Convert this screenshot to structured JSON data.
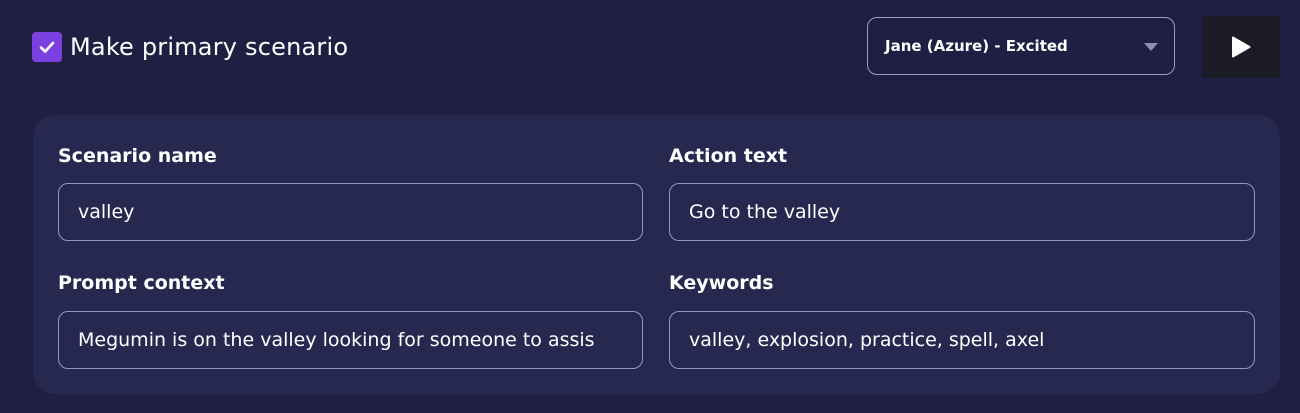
{
  "header": {
    "primary_checkbox": {
      "label": "Make primary scenario",
      "checked": true
    },
    "voice_select": {
      "value": "Jane (Azure) - Excited"
    },
    "play_button": {
      "icon": "play-icon"
    }
  },
  "form": {
    "scenario_name": {
      "label": "Scenario name",
      "value": "valley"
    },
    "action_text": {
      "label": "Action text",
      "value": "Go to the valley"
    },
    "prompt_context": {
      "label": "Prompt context",
      "value": "Megumin is on the valley looking for someone to assis"
    },
    "keywords": {
      "label": "Keywords",
      "value": "valley, explosion, practice, spell, axel"
    }
  },
  "colors": {
    "background": "#1e1f42",
    "panel": "#272850",
    "accent": "#7c3fe0",
    "border": "#9395bf"
  }
}
